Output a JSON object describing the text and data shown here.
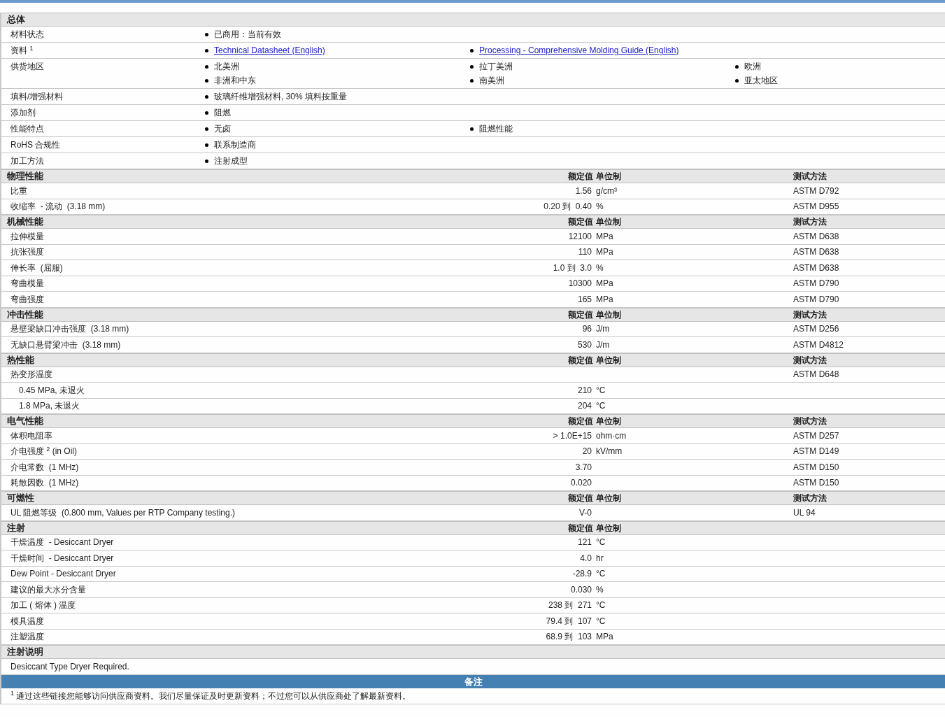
{
  "general": {
    "title": "总体",
    "rows": [
      {
        "label": "材料状态",
        "items": [
          {
            "kind": "text",
            "text": "已商用：当前有效"
          }
        ]
      },
      {
        "label": "资料 $^{1}$",
        "items": [
          {
            "kind": "link",
            "text": "Technical Datasheet (English)"
          },
          {
            "kind": "link",
            "text": "Processing - Comprehensive Molding Guide (English)"
          }
        ]
      },
      {
        "label": "供货地区",
        "items": [
          {
            "kind": "text",
            "text": "北美洲"
          },
          {
            "kind": "text",
            "text": "拉丁美洲"
          },
          {
            "kind": "text",
            "text": "欧洲"
          },
          {
            "kind": "text",
            "text": "非洲和中东"
          },
          {
            "kind": "text",
            "text": "南美洲"
          },
          {
            "kind": "text",
            "text": "亚太地区"
          }
        ]
      },
      {
        "label": "填料/增强材料",
        "items": [
          {
            "kind": "text",
            "text": "玻璃纤维增强材料, 30% 填料按重量"
          }
        ]
      },
      {
        "label": "添加剂",
        "items": [
          {
            "kind": "text",
            "text": "阻燃"
          }
        ]
      },
      {
        "label": "性能特点",
        "items": [
          {
            "kind": "text",
            "text": "无卤"
          },
          {
            "kind": "text",
            "text": "阻燃性能"
          }
        ]
      },
      {
        "label": "RoHS 合规性",
        "items": [
          {
            "kind": "text",
            "text": "联系制造商"
          }
        ]
      },
      {
        "label": "加工方法",
        "items": [
          {
            "kind": "text",
            "text": "注射成型"
          }
        ]
      }
    ]
  },
  "sections": [
    {
      "title": "物理性能",
      "value_header": "额定值",
      "unit_header": "单位制",
      "method_header": "测试方法",
      "rows": [
        {
          "label": "比重",
          "value": "1.56",
          "unit": "g/cm³",
          "method": "ASTM D792"
        },
        {
          "label": "收缩率  - 流动  (3.18 mm)",
          "value": "0.20 到  0.40",
          "unit": "%",
          "method": "ASTM D955"
        }
      ]
    },
    {
      "title": "机械性能",
      "value_header": "额定值",
      "unit_header": "单位制",
      "method_header": "测试方法",
      "rows": [
        {
          "label": "拉伸模量",
          "value": "12100",
          "unit": "MPa",
          "method": "ASTM D638"
        },
        {
          "label": "抗张强度",
          "value": "110",
          "unit": "MPa",
          "method": "ASTM D638"
        },
        {
          "label": "伸长率  (屈服)",
          "value": "1.0 到  3.0",
          "unit": "%",
          "method": "ASTM D638"
        },
        {
          "label": "弯曲模量",
          "value": "10300",
          "unit": "MPa",
          "method": "ASTM D790"
        },
        {
          "label": "弯曲强度",
          "value": "165",
          "unit": "MPa",
          "method": "ASTM D790"
        }
      ]
    },
    {
      "title": "冲击性能",
      "value_header": "额定值",
      "unit_header": "单位制",
      "method_header": "测试方法",
      "rows": [
        {
          "label": "悬壁梁缺口冲击强度  (3.18 mm)",
          "value": "96",
          "unit": "J/m",
          "method": "ASTM D256"
        },
        {
          "label": "无缺口悬臂梁冲击  (3.18 mm)",
          "value": "530",
          "unit": "J/m",
          "method": "ASTM D4812"
        }
      ]
    },
    {
      "title": "热性能",
      "value_header": "额定值",
      "unit_header": "单位制",
      "method_header": "测试方法",
      "rows": [
        {
          "label": "热变形温度",
          "method": "ASTM D648",
          "children": [
            {
              "label": "0.45 MPa, 未退火",
              "value": "210",
              "unit": "°C"
            },
            {
              "label": "1.8 MPa, 未退火",
              "value": "204",
              "unit": "°C"
            }
          ]
        }
      ]
    },
    {
      "title": "电气性能",
      "value_header": "额定值",
      "unit_header": "单位制",
      "method_header": "测试方法",
      "rows": [
        {
          "label": "体积电阻率",
          "value": "> 1.0E+15",
          "unit": "ohm·cm",
          "method": "ASTM D257"
        },
        {
          "label": "介电强度 $^{2}$ (in Oil)",
          "value": "20",
          "unit": "kV/mm",
          "method": "ASTM D149"
        },
        {
          "label": "介电常数  (1 MHz)",
          "value": "3.70",
          "method": "ASTM D150"
        },
        {
          "label": "耗散因数  (1 MHz)",
          "value": "0.020",
          "method": "ASTM D150"
        }
      ]
    },
    {
      "title": "可燃性",
      "value_header": "额定值",
      "unit_header": "单位制",
      "method_header": "测试方法",
      "rows": [
        {
          "label": "UL 阻燃等级  (0.800 mm, Values per RTP Company testing.)",
          "value": "V-0",
          "method": "UL 94"
        }
      ]
    },
    {
      "title": "注射",
      "value_header": "额定值",
      "unit_header": "单位制",
      "rows": [
        {
          "label": "干燥温度  - Desiccant Dryer",
          "value": "121",
          "unit": "°C"
        },
        {
          "label": "干燥时间  - Desiccant Dryer",
          "value": "4.0",
          "unit": "hr"
        },
        {
          "label": "Dew Point - Desiccant Dryer",
          "value": "-28.9",
          "unit": "°C"
        },
        {
          "label": "建议的最大水分含量",
          "value": "0.030",
          "unit": "%"
        },
        {
          "label": "加工 ( 熔体 ) 温度",
          "value": "238 到  271",
          "unit": "°C"
        },
        {
          "label": "模具温度",
          "value": "79.4 到  107",
          "unit": "°C"
        },
        {
          "label": "注塑温度",
          "value": "68.9 到  103",
          "unit": "MPa"
        }
      ]
    },
    {
      "title": "注射说明",
      "rows": [
        {
          "label": "Desiccant Type Dryer Required."
        }
      ]
    }
  ],
  "notes": {
    "title": "备注",
    "items": [
      "$^{1}$ 通过这些链接您能够访问供应商资料。我们尽量保证及时更新资料；不过您可以从供应商处了解最新资料。"
    ]
  }
}
